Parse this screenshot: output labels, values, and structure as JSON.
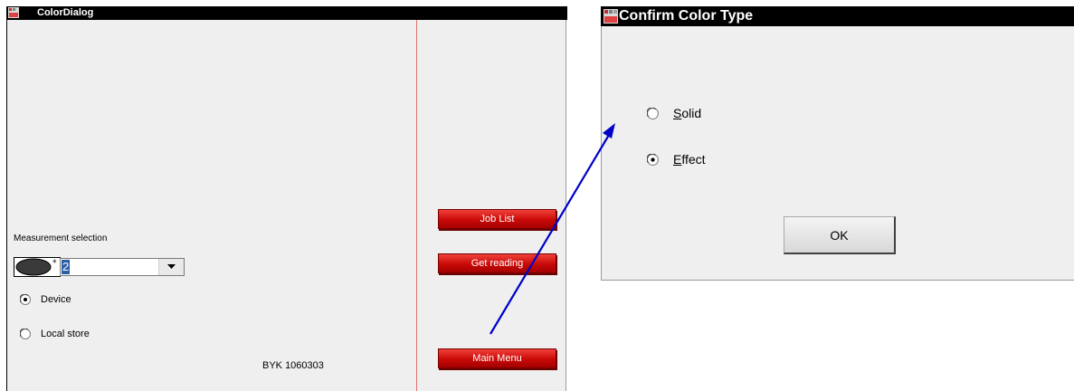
{
  "color_dialog": {
    "title": "ColorDialog",
    "measurement_label": "Measurement selection",
    "measurement_value": "2",
    "source_options": [
      {
        "label": "Device",
        "selected": true
      },
      {
        "label": "Local store",
        "selected": false
      }
    ],
    "device_id": "BYK 1060303",
    "buttons": {
      "job_list": "Job List",
      "get_reading": "Get reading",
      "main_menu": "Main Menu"
    }
  },
  "confirm_dialog": {
    "title": "Confirm Color Type",
    "options": [
      {
        "first": "S",
        "rest": "olid",
        "selected": false
      },
      {
        "first": "E",
        "rest": "ffect",
        "selected": true
      }
    ],
    "ok_label": "OK"
  },
  "colors": {
    "button_red": "#d4120e",
    "arrow_blue": "#0000c8",
    "title_bar": "#000000",
    "window_bg": "#efefef"
  }
}
